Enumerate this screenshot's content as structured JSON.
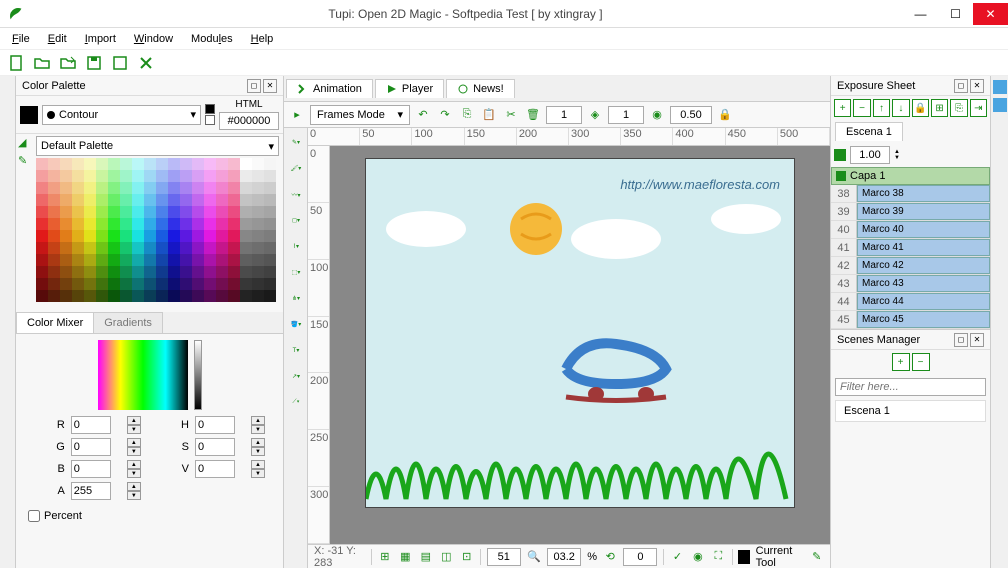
{
  "title": "Tupi: Open 2D Magic - Softpedia Test [ by xtingray ]",
  "menu": [
    "File",
    "Edit",
    "Import",
    "Window",
    "Modules",
    "Help"
  ],
  "palette_panel": {
    "title": "Color Palette",
    "contour_label": "Contour",
    "html_label": "HTML",
    "html_value": "#000000",
    "default_label": "Default Palette"
  },
  "mixer": {
    "tab1": "Color Mixer",
    "tab2": "Gradients",
    "R": "0",
    "G": "0",
    "B": "0",
    "A": "255",
    "H": "0",
    "S": "0",
    "V": "0",
    "percent_label": "Percent"
  },
  "center": {
    "tab_animation": "Animation",
    "tab_player": "Player",
    "tab_news": "News!",
    "frames_mode": "Frames Mode",
    "frame_num1": "1",
    "frame_num2": "1",
    "opacity": "0.50",
    "canvas_url": "http://www.maefloresta.com",
    "hruler": [
      "0",
      "50",
      "100",
      "150",
      "200",
      "300",
      "350",
      "400",
      "450",
      "500"
    ],
    "vruler": [
      "0",
      "50",
      "100",
      "150",
      "200",
      "250",
      "300"
    ]
  },
  "status": {
    "coords": "X: -31 Y: 283",
    "zoom1": "51",
    "zoom2": "03.2",
    "unit": "%",
    "angle": "0",
    "tool_label": "Current Tool"
  },
  "exposure": {
    "title": "Exposure Sheet",
    "scene": "Escena 1",
    "frame_val": "1.00",
    "layer": "Capa 1",
    "rows": [
      {
        "n": "38",
        "label": "Marco 38"
      },
      {
        "n": "39",
        "label": "Marco 39"
      },
      {
        "n": "40",
        "label": "Marco 40"
      },
      {
        "n": "41",
        "label": "Marco 41"
      },
      {
        "n": "42",
        "label": "Marco 42"
      },
      {
        "n": "43",
        "label": "Marco 43"
      },
      {
        "n": "44",
        "label": "Marco 44"
      },
      {
        "n": "45",
        "label": "Marco 45"
      }
    ]
  },
  "scenes": {
    "title": "Scenes Manager",
    "filter_placeholder": "Filter here...",
    "item": "Escena 1"
  }
}
